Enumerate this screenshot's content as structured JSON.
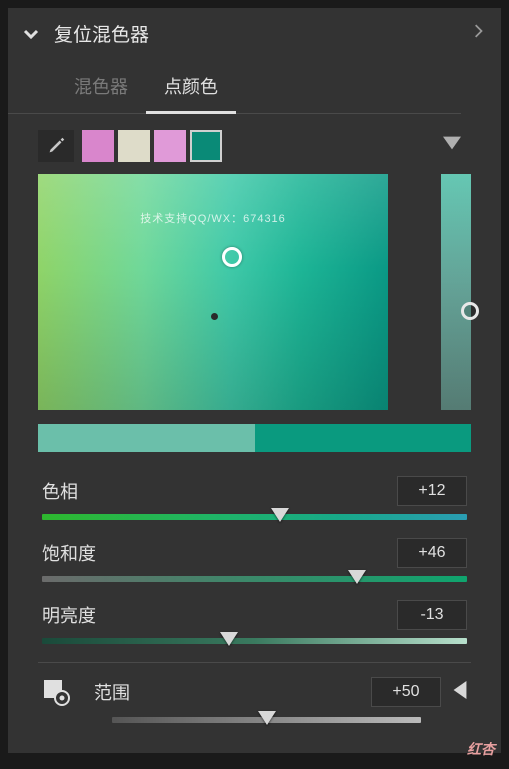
{
  "header": {
    "title": "复位混色器"
  },
  "tabs": {
    "mixer": "混色器",
    "point": "点颜色"
  },
  "swatches": {
    "colors": [
      "#d986cc",
      "#dedcc9",
      "#e09ad8",
      "#0a8a77"
    ],
    "selected": 3
  },
  "watermark": "技术支持QQ/WX：674316",
  "dual_bar": {
    "left": "#6bbfaa",
    "right": "#0a9a7f"
  },
  "sliders": {
    "hue": {
      "label": "色相",
      "value": "+12",
      "pos": 56
    },
    "sat": {
      "label": "饱和度",
      "value": "+46",
      "pos": 74
    },
    "light": {
      "label": "明亮度",
      "value": "-13",
      "pos": 44
    }
  },
  "range": {
    "label": "范围",
    "value": "+50",
    "pos": 50
  },
  "footer": "红杏"
}
